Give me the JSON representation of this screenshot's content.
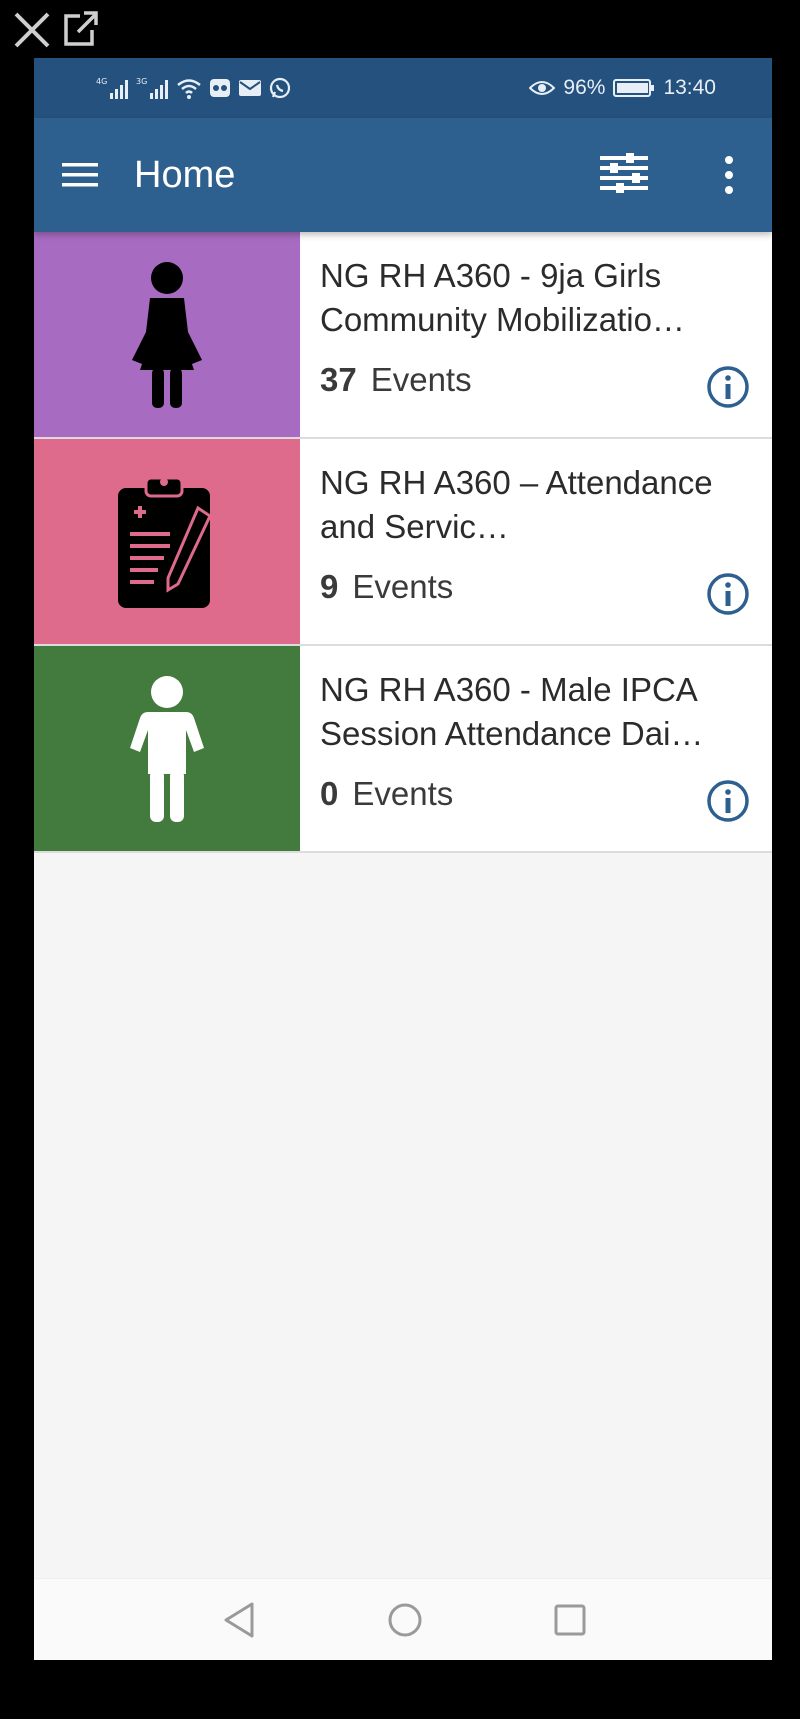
{
  "overlay": {
    "close_icon": "close-icon",
    "open_external_icon": "open-external-icon"
  },
  "status_bar": {
    "battery": "96%",
    "time": "13:40",
    "icons": [
      "signal-4g-icon",
      "signal-3g-icon",
      "wifi-icon",
      "vpn-icon",
      "mail-icon",
      "whatsapp-icon",
      "eye-icon",
      "battery-icon"
    ]
  },
  "app_bar": {
    "title": "Home",
    "menu_icon": "hamburger-menu-icon",
    "filter_icon": "filter-icon",
    "more_icon": "more-vertical-icon"
  },
  "programs": [
    {
      "title": "NG RH A360 - 9ja Girls Community Mobilizatio…",
      "count": "37",
      "count_label": "Events",
      "color": "#a86bc2",
      "icon": "female-person-icon"
    },
    {
      "title": "NG RH A360 – Attendance and Servic…",
      "count": "9",
      "count_label": "Events",
      "color": "#de6a8c",
      "icon": "clipboard-pencil-icon"
    },
    {
      "title": "NG RH A360 - Male IPCA Session Attendance Dai…",
      "count": "0",
      "count_label": "Events",
      "color": "#437a3d",
      "icon": "male-person-icon"
    }
  ],
  "colors": {
    "status_bar": "#24517d",
    "app_bar": "#2d5f8f",
    "info_icon": "#2d5f8f",
    "background": "#f5f5f5"
  },
  "nav_bar": {
    "back_icon": "back-triangle-icon",
    "home_icon": "home-circle-icon",
    "recent_icon": "recent-apps-square-icon"
  }
}
